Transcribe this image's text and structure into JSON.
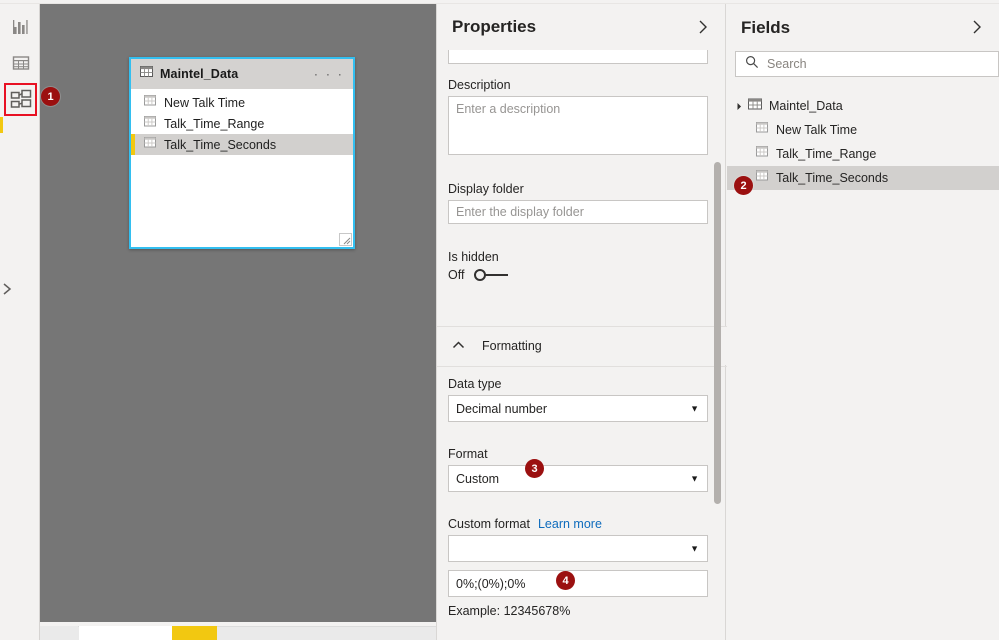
{
  "rail": {
    "items": [
      {
        "name": "report-view",
        "icon": "bar-chart-icon",
        "selected": false
      },
      {
        "name": "data-view",
        "icon": "table-grid-icon",
        "selected": false
      },
      {
        "name": "model-view",
        "icon": "model-relationship-icon",
        "selected": true
      }
    ],
    "expand_tooltip": "Expand"
  },
  "canvas": {
    "table_card": {
      "title": "Maintel_Data",
      "ellipsis": "· · ·",
      "header_icon": "table-icon",
      "columns": [
        {
          "label": "New Talk Time",
          "icon": "column-icon",
          "selected": false
        },
        {
          "label": "Talk_Time_Range",
          "icon": "column-icon",
          "selected": false
        },
        {
          "label": "Talk_Time_Seconds",
          "icon": "column-icon",
          "selected": true
        }
      ],
      "resize_handle": "resize-grip-icon"
    }
  },
  "properties": {
    "title": "Properties",
    "collapse_icon": "chevron-right-icon",
    "name_field_value": "",
    "description": {
      "label": "Description",
      "placeholder": "Enter a description",
      "value": ""
    },
    "display_folder": {
      "label": "Display folder",
      "placeholder": "Enter the display folder",
      "value": ""
    },
    "is_hidden": {
      "label": "Is hidden",
      "state_label": "Off",
      "on": false
    },
    "formatting": {
      "section_label": "Formatting",
      "collapse_icon": "chevron-up-icon",
      "data_type": {
        "label": "Data type",
        "value": "Decimal number",
        "caret": "▼"
      },
      "format": {
        "label": "Format",
        "value": "Custom",
        "caret": "▼"
      },
      "custom_format": {
        "label": "Custom format",
        "learn_more": "Learn more",
        "dropdown_value": "",
        "caret": "▼",
        "input_value": "0%;(0%);0%",
        "example": "Example: 12345678%"
      }
    }
  },
  "fields": {
    "title": "Fields",
    "collapse_icon": "chevron-right-icon",
    "search": {
      "placeholder": "Search",
      "value": "",
      "icon": "search-icon"
    },
    "tree": {
      "table": {
        "label": "Maintel_Data",
        "icon": "table-icon",
        "expanded": true
      },
      "items": [
        {
          "label": "New Talk Time",
          "icon": "column-icon",
          "selected": false
        },
        {
          "label": "Talk_Time_Range",
          "icon": "column-icon",
          "selected": false
        },
        {
          "label": "Talk_Time_Seconds",
          "icon": "column-icon",
          "selected": true
        }
      ]
    }
  },
  "callouts": [
    {
      "number": "1",
      "target": "model-view-rail-button"
    },
    {
      "number": "2",
      "target": "fields-talk-time-seconds"
    },
    {
      "number": "3",
      "target": "format-dropdown"
    },
    {
      "number": "4",
      "target": "custom-format-input"
    }
  ],
  "colors": {
    "accent_yellow": "#f2c811",
    "selection_blue": "#33bff0",
    "callout_red": "#9b1010",
    "highlight_red": "#e81123",
    "link_blue": "#0f6cbd",
    "canvas_gray": "#767676"
  }
}
